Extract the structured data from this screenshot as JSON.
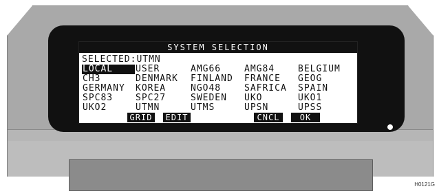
{
  "screen": {
    "title": "SYSTEM SELECTION",
    "selected_text": "SELECTED:UTMN",
    "highlight_index": 0,
    "systems": [
      "LOCAL",
      "USER",
      "AMG66",
      "AMG84",
      "BELGIUM",
      "CH3",
      "DENMARK",
      "FINLAND",
      "FRANCE",
      "GEOG",
      "GERMANY",
      "KOREA",
      "NGO48",
      "SAFRICA",
      "SPAIN",
      "SPC83",
      "SPC27",
      "SWEDEN",
      "UKO",
      "UKO1",
      "UKO2",
      "UTMN",
      "UTMS",
      "UPSN",
      "UPSS"
    ],
    "softkeys": {
      "grid": "GRID",
      "edit": "EDIT",
      "cncl": "CNCL",
      "ok": "OK"
    }
  },
  "figure_code": "H0121G"
}
